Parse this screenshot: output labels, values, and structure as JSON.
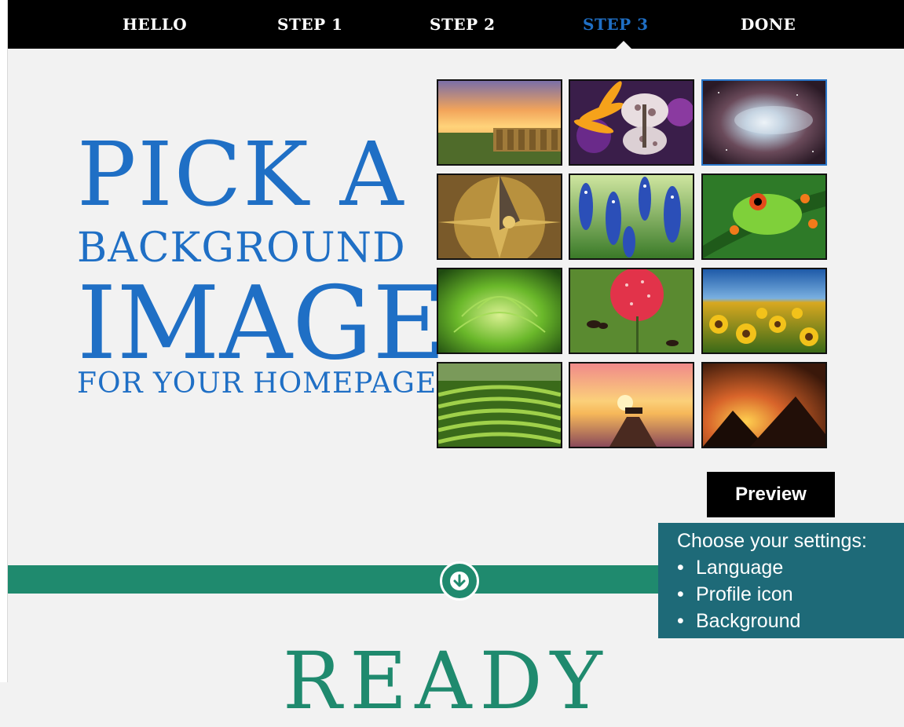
{
  "nav": {
    "items": [
      {
        "label": "HELLO",
        "active": false
      },
      {
        "label": "STEP 1",
        "active": false
      },
      {
        "label": "STEP 2",
        "active": false
      },
      {
        "label": "STEP 3",
        "active": true
      },
      {
        "label": "DONE",
        "active": false
      }
    ]
  },
  "headline": {
    "line1": "PICK A",
    "line2": "BACKGROUND",
    "line3": "IMAGE",
    "line4": "FOR YOUR HOMEPAGE"
  },
  "thumbnails": [
    {
      "name": "hay-bales-sunset",
      "selected": false
    },
    {
      "name": "butterfly-flower",
      "selected": false
    },
    {
      "name": "nebula-space",
      "selected": true
    },
    {
      "name": "sundial-compass",
      "selected": false
    },
    {
      "name": "bluebonnets",
      "selected": false
    },
    {
      "name": "tree-frog",
      "selected": false
    },
    {
      "name": "green-succulent",
      "selected": false
    },
    {
      "name": "ants-strawberry",
      "selected": false
    },
    {
      "name": "sunflower-field",
      "selected": false
    },
    {
      "name": "tea-terraces",
      "selected": false
    },
    {
      "name": "pier-sunset",
      "selected": false
    },
    {
      "name": "pyramids-sunset",
      "selected": false
    }
  ],
  "preview_label": "Preview",
  "tooltip": {
    "title": "Choose your settings:",
    "items": [
      "Language",
      "Profile icon",
      "Background"
    ]
  },
  "footer": {
    "heading": "READY"
  },
  "colors": {
    "accent": "#1f6fc5",
    "green": "#1f8a6e",
    "tooltip_bg": "#1e6a78"
  }
}
